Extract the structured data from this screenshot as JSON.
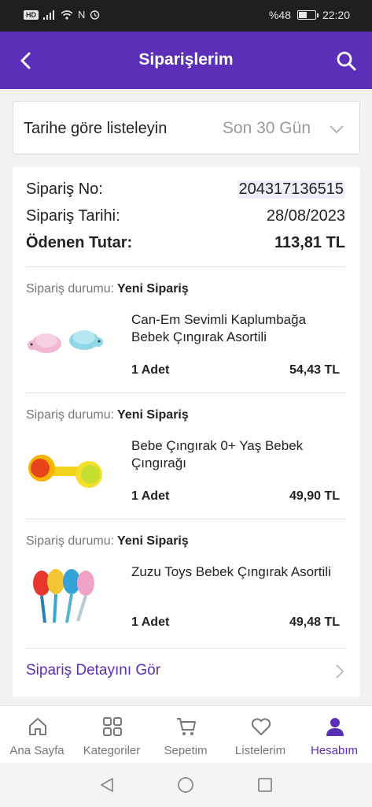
{
  "status_bar": {
    "hd": "HD",
    "battery_text": "%48",
    "battery_level": 0.48,
    "time": "22:20"
  },
  "header": {
    "title": "Siparişlerim",
    "back_icon": "back-arrow-icon",
    "search_icon": "search-icon",
    "color": "#5b2fb8"
  },
  "filter": {
    "label": "Tarihe göre listeleyin",
    "selected": "Son 30 Gün"
  },
  "order": {
    "no_label": "Sipariş No:",
    "no_value": "204317136515",
    "date_label": "Sipariş Tarihi:",
    "date_value": "28/08/2023",
    "total_label": "Ödenen Tutar:",
    "total_value": "113,81 TL",
    "items": [
      {
        "status_label": "Sipariş durumu:",
        "status_value": "Yeni Sipariş",
        "name": "Can-Em Sevimli Kaplumbağa Bebek Çıngırak Asortili",
        "qty": "1 Adet",
        "price": "54,43 TL",
        "image": "turtle-rattle-image"
      },
      {
        "status_label": "Sipariş durumu:",
        "status_value": "Yeni Sipariş",
        "name": "Bebe Çıngırak 0+ Yaş Bebek Çıngırağı",
        "qty": "1 Adet",
        "price": "49,90 TL",
        "image": "ball-rattle-image"
      },
      {
        "status_label": "Sipariş durumu:",
        "status_value": "Yeni Sipariş",
        "name": "Zuzu Toys Bebek Çıngırak Asortili",
        "qty": "1 Adet",
        "price": "49,48 TL",
        "image": "maracas-rattle-image"
      }
    ],
    "detail_link": "Sipariş Detayını Gör"
  },
  "tabs": [
    {
      "label": "Ana Sayfa",
      "icon": "home-icon",
      "active": false
    },
    {
      "label": "Kategoriler",
      "icon": "grid-icon",
      "active": false
    },
    {
      "label": "Sepetim",
      "icon": "cart-icon",
      "active": false
    },
    {
      "label": "Listelerim",
      "icon": "heart-icon",
      "active": false
    },
    {
      "label": "Hesabım",
      "icon": "user-icon",
      "active": true
    }
  ]
}
